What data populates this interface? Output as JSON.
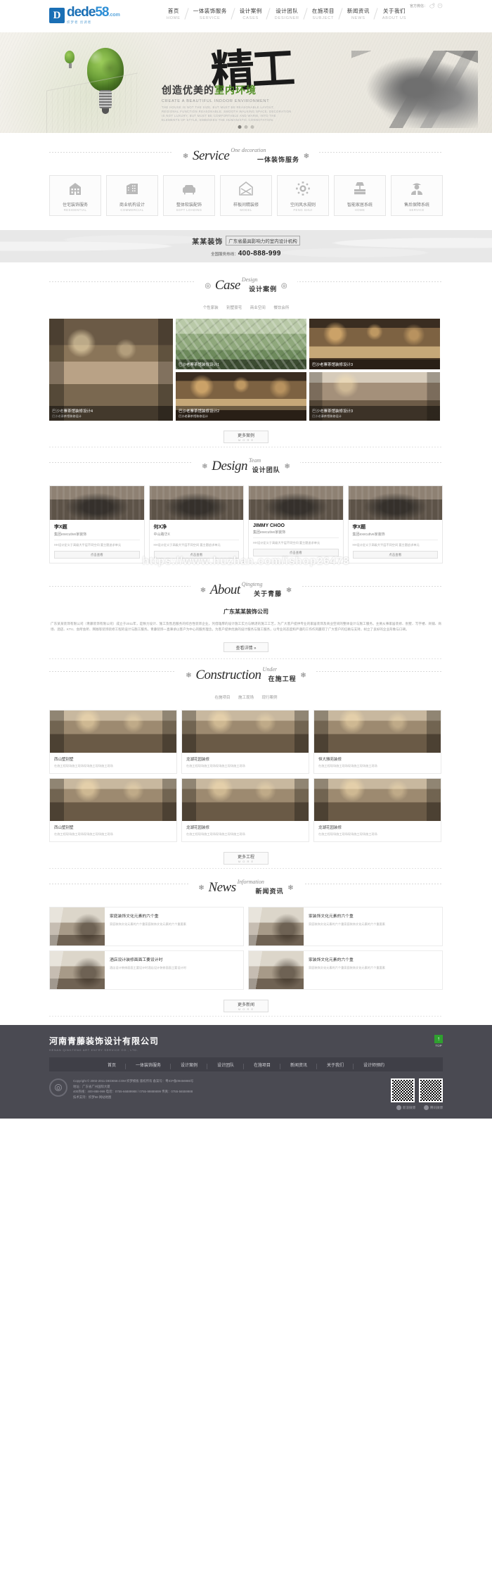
{
  "header": {
    "logo": {
      "mark": "D",
      "word1": "dede",
      "word2": "58",
      "com": ".com",
      "sub": "织梦者 创调者"
    },
    "wechat_label": "官方微信：",
    "nav": [
      {
        "cn": "首页",
        "en": "HOME"
      },
      {
        "cn": "一体装饰服务",
        "en": "SERVICE"
      },
      {
        "cn": "设计案例",
        "en": "CASES"
      },
      {
        "cn": "设计团队",
        "en": "DESIGNER"
      },
      {
        "cn": "在施项目",
        "en": "SUBJECT"
      },
      {
        "cn": "新闻资讯",
        "en": "NEWS"
      },
      {
        "cn": "关于我们",
        "en": "ABOUT US"
      }
    ]
  },
  "banner": {
    "big_char": "精工",
    "title_a": "创造优美的",
    "title_b": "室内环境",
    "sub_en": "CREATE A BEAUTIFUL INDOOR ENVIRONMENT",
    "desc_en": "THE HOUSE IS NOT THE SIZE, BUT MUST BE REASONABLE LAYOUT, REGIONAL FUNCTION REASONABLE, SMOOTH WALKING SPACE. DECORATION IS NOT LUXURY, BUT MUST BE COMFORTABLE AND WARM, INTO THE ELEMENTS OF STYLE, EMBODIES THE HUMANISTIC CONNOTATION."
  },
  "service": {
    "title_en": "Service",
    "title_sup": "One decoration",
    "title_cn": "一体装饰服务",
    "items": [
      {
        "cn": "住宅装饰服务",
        "en": "RESIDENTIAL",
        "icon": "house-icon"
      },
      {
        "cn": "商业机构设计",
        "en": "COMMERCIAL",
        "icon": "office-building-icon"
      },
      {
        "cn": "整体软装配饰",
        "en": "SOFT LOADING",
        "icon": "sofa-icon"
      },
      {
        "cn": "样板间精装修",
        "en": "MODEL",
        "icon": "model-house-icon"
      },
      {
        "cn": "空间风水规则",
        "en": "FENG SHUI",
        "icon": "compass-icon"
      },
      {
        "cn": "智能家居系统",
        "en": "HOME",
        "icon": "smart-lamp-icon"
      },
      {
        "cn": "售后保障系统",
        "en": "SERVICE",
        "icon": "worker-icon"
      }
    ]
  },
  "phonebar": {
    "brand": "某某装饰",
    "slogan": "广东省最具影响力的室内设计机构",
    "hotline_label": "全国服务热线：",
    "hotline": "400-888-999"
  },
  "case": {
    "title_en": "Case",
    "title_sup": "Design",
    "title_cn": "设计案例",
    "subnav": [
      "个性家装",
      "别墅豪宅",
      "商业空间",
      "餐饮会所"
    ],
    "items": [
      {
        "title": "巴沙老寨茶馆装修设计4",
        "desc": "巴沙老寨茶馆装修设计",
        "style": "img-room"
      },
      {
        "title": "巴沙老寨茶馆装修设计2",
        "desc": "巴沙老寨茶馆装修设计",
        "style": "img-cafe"
      },
      {
        "title": "巴沙老寨茶馆装修设计1",
        "desc": "巴沙老寨茶馆装修设计",
        "style": "img-aerial"
      },
      {
        "title": "巴沙老寨茶馆装修设计3",
        "desc": "巴沙老寨茶馆装修设计",
        "style": "img-living"
      }
    ],
    "more": {
      "t": "更多案例",
      "m": "M O R E"
    }
  },
  "designer": {
    "title_en": "Design",
    "title_sup": "Team",
    "title_cn": "设计团队",
    "items": [
      {
        "name": "李X题",
        "title": "集团executive家装饰",
        "desc": "HH设计定义于高级大平层不同空间\n要主题追求单元",
        "btn": "点击查看"
      },
      {
        "name": "何X净",
        "title": "中山路华X",
        "desc": "HH设计定义于高级大平层不同空间\n要主题追求单元",
        "btn": "点击查看"
      },
      {
        "name": "JIMMY CHOO",
        "title": "集团executive家装饰",
        "desc": "HH设计定义于高级大平层不同空间\n要主题追求单元",
        "btn": "点击查看"
      },
      {
        "name": "李X题",
        "title": "集团executive家装饰",
        "desc": "HH设计定义于高级大平层不同空间\n要主题追求单元",
        "btn": "点击查看"
      }
    ]
  },
  "watermark": "https://www.huzhan.com/ishop26473",
  "about": {
    "title_en": "About",
    "title_sup": "Qingteng",
    "title_cn": "关于青藤",
    "heading": "广东某某装饰公司",
    "body": "广东某某装饰有限公司（青藤装饰有限公司）成立于2011年，是致力设计、施工及售后服务的综合性装饰企业，凭借雄厚的设计施工实力与精湛的施工工艺，为广大客户提供专业的家居装饰及商业空间的整体设计与施工服务。主要从事家居装修、别墅、写字楼、商铺、商场、酒店、KTV、会所会所、网咖等装饰装修工程的设计与施工服务。青藤装饰一直秉承以客户为中心的服务理念，为客户提供优质的设计服务与施工服务，以专业的态度和严谨的工作作风赢得了广大客户的信赖与支持，树立了良好的企业形象与口碑。",
    "btn": "查看详情 »"
  },
  "construction": {
    "title_en": "Construction",
    "title_sup": "Under",
    "title_cn": "在施工程",
    "subnav": [
      "在施项目",
      "施工现场",
      "现行案例"
    ],
    "items": [
      {
        "title": "西山墅别墅",
        "desc": "在施工程现场施工现场现场施工现场施工现场"
      },
      {
        "title": "龙湖花园装修",
        "desc": "在施工程现场施工现场现场施工现场施工现场"
      },
      {
        "title": "恒大雅苑装修",
        "desc": "在施工程现场施工现场现场施工现场施工现场"
      },
      {
        "title": "西山墅别墅",
        "desc": "在施工程现场施工现场现场施工现场施工现场"
      },
      {
        "title": "龙湖花园装修",
        "desc": "在施工程现场施工现场现场施工现场施工现场"
      },
      {
        "title": "龙湖花园装修",
        "desc": "在施工程现场施工现场现场施工现场施工现场"
      }
    ],
    "more": {
      "t": "更多工程",
      "m": "M O R E"
    }
  },
  "news": {
    "title_en": "News",
    "title_sup": "Information",
    "title_cn": "新闻资讯",
    "items": [
      {
        "title": "家庭装饰文化元素的六个重",
        "desc": "家庭装饰文化元素的六个重家庭装饰文化元素的六个重要素"
      },
      {
        "title": "家装饰文化元素的六个重",
        "desc": "家庭装饰文化元素的六个重家庭装饰文化元素的六个重要素"
      },
      {
        "title": "酒店设计装修面面工要设计时",
        "desc": "酒店设计装修面面工要设计时酒店设计装修面面工要设计时"
      },
      {
        "title": "家装饰文化元素的六个重",
        "desc": "家庭装饰文化元素的六个重家庭装饰文化元素的六个重要素"
      }
    ],
    "more": {
      "t": "更多新闻",
      "m": "M O R E"
    }
  },
  "footer": {
    "company_cn": "河南青藤装饰设计有限公司",
    "company_en": "HENAN QINGTENG ART ENTRY SERVICE CO., LTD.",
    "top_label": "TOP",
    "top_arrow": "↑",
    "nav": [
      "首页",
      "一体装饰服务",
      "设计案例",
      "设计团队",
      "在施项目",
      "新闻资讯",
      "关于我们",
      "设计师预约"
    ],
    "copy": [
      "Copyright © 2002-2011 DEDE58.COM 织梦模板 版权所有 备案号：粤ICP备09456986号",
      "地址：广东省广州国际大厦",
      "400热线：400-888-999 电话：0755-66889988 / 0755-99889899 传真：0755-56559988",
      "技术支持：织梦58 网站地图"
    ],
    "social": [
      {
        "label": "新浪微博",
        "icon": "weibo-icon"
      },
      {
        "label": "腾讯微博",
        "icon": "qq-icon"
      }
    ]
  }
}
